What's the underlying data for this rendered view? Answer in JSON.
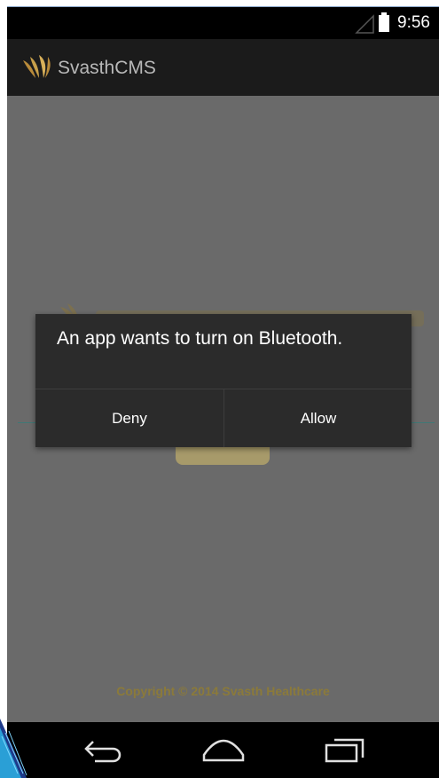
{
  "status_bar": {
    "time": "9:56",
    "signal_icon": "signal-icon",
    "battery_icon": "battery-icon"
  },
  "action_bar": {
    "title": "SvasthCMS",
    "logo_icon": "leaf-logo-icon"
  },
  "background": {
    "copyright": "Copyright © 2014 Svasth Healthcare"
  },
  "dialog": {
    "message": "An app wants to turn on Bluetooth.",
    "deny_label": "Deny",
    "allow_label": "Allow"
  },
  "nav_bar": {
    "back_icon": "back-icon",
    "home_icon": "home-icon",
    "recents_icon": "recents-icon"
  },
  "colors": {
    "status_bar_bg": "#000000",
    "action_bar_bg": "#1b1b1b",
    "content_dimmed_bg": "#6a6a6a",
    "dialog_bg": "#2b2b2b",
    "brand_gold": "#c8a04a",
    "copyright_text": "#8b7a3a"
  }
}
